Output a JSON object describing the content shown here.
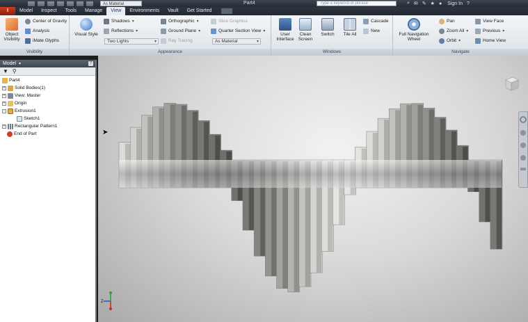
{
  "title_bar": {
    "quick_access_dropdown": "As Material",
    "document_title": "Part4",
    "search_placeholder": "Type a keyword or phrase",
    "sign_in": "Sign In"
  },
  "app_button_label": "I",
  "tabs": [
    {
      "label": "Model",
      "active": false
    },
    {
      "label": "Inspect",
      "active": false
    },
    {
      "label": "Tools",
      "active": false
    },
    {
      "label": "Manage",
      "active": false
    },
    {
      "label": "View",
      "active": true
    },
    {
      "label": "Environments",
      "active": false
    },
    {
      "label": "Vault",
      "active": false
    },
    {
      "label": "Get Started",
      "active": false
    }
  ],
  "ribbon": {
    "visibility": {
      "title": "Visibility",
      "object_visibility": "Object Visibility",
      "center_of_gravity": "Center of Gravity",
      "analysis": "Analysis",
      "imate_glyphs": "iMate Glyphs"
    },
    "appearance": {
      "title": "Appearance",
      "visual_style": "Visual Style",
      "shadows": "Shadows",
      "reflections": "Reflections",
      "lights_combo": "Two Lights",
      "orthographic": "Orthographic",
      "ground_plane": "Ground Plane",
      "ray_tracing": "Ray Tracing",
      "slice_graphics": "Slice Graphics",
      "quarter_section_view": "Quarter Section View",
      "material_combo": "As Material"
    },
    "windows": {
      "title": "Windows",
      "user_interface": "User Interface",
      "clean_screen": "Clean Screen",
      "switch": "Switch",
      "tile_all": "Tile All",
      "cascade": "Cascade",
      "new": "New"
    },
    "navigate": {
      "title": "Navigate",
      "full_navigation_wheel": "Full Navigation Wheel",
      "pan": "Pan",
      "zoom_all": "Zoom All",
      "orbit": "Orbit",
      "view_face": "View Face",
      "previous": "Previous",
      "home_view": "Home View"
    }
  },
  "browser": {
    "header": "Model",
    "help": "?",
    "tree": [
      {
        "label": "Part4",
        "expander": ""
      },
      {
        "label": "Solid Bodies(1)",
        "expander": "+"
      },
      {
        "label": "View: Master",
        "expander": "+"
      },
      {
        "label": "Origin",
        "expander": "+"
      },
      {
        "label": "Extrusion1",
        "expander": "-"
      },
      {
        "label": "Sketch1",
        "expander": ""
      },
      {
        "label": "Rectangular Pattern1",
        "expander": "+"
      },
      {
        "label": "End of Part",
        "expander": ""
      }
    ]
  },
  "viewport": {
    "triad_labels": {
      "z": "Z",
      "x": "X",
      "y": "Y"
    }
  },
  "colors": {
    "titlebar": "#2b313a",
    "ribbon": "#e4e8ed",
    "active_tab": "#e9edf2",
    "app_button": "#b4301b",
    "viewport_light": "#f2f2f2",
    "viewport_dark": "#a9a9a9"
  }
}
